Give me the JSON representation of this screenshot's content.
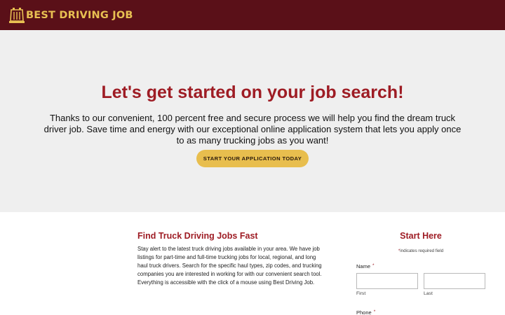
{
  "header": {
    "logo_text": "BEST DRIVING JOB",
    "brand_color": "#5a1018",
    "logo_color": "#e8c052"
  },
  "hero": {
    "title": "Let's get started on your job search!",
    "text": "Thanks to our convenient, 100 percent free and secure process we will help you find the dream truck driver job. Save time and energy with our exceptional online application system that lets you apply once to as many trucking jobs as you want!",
    "cta_label": "START YOUR APPLICATION TODAY",
    "cta_color": "#e8be4e"
  },
  "info": {
    "title": "Find Truck Driving Jobs Fast",
    "text": "Stay alert to the latest truck driving jobs available in your area. We have job listings for part-time and full-time trucking jobs for local, regional, and long haul truck drivers. Search for the specific haul types, zip codes, and trucking companies you are interested in working for with our convenient search tool. Everything is accessible with the click of a mouse using Best Driving Job."
  },
  "form": {
    "title": "Start Here",
    "required_marker": "*",
    "required_note": "indicates required field",
    "name_label": "Name",
    "first_label": "First",
    "last_label": "Last",
    "first_value": "",
    "last_value": "",
    "phone_label": "Phone"
  },
  "icons": {
    "logo": "truck-grille-icon"
  }
}
